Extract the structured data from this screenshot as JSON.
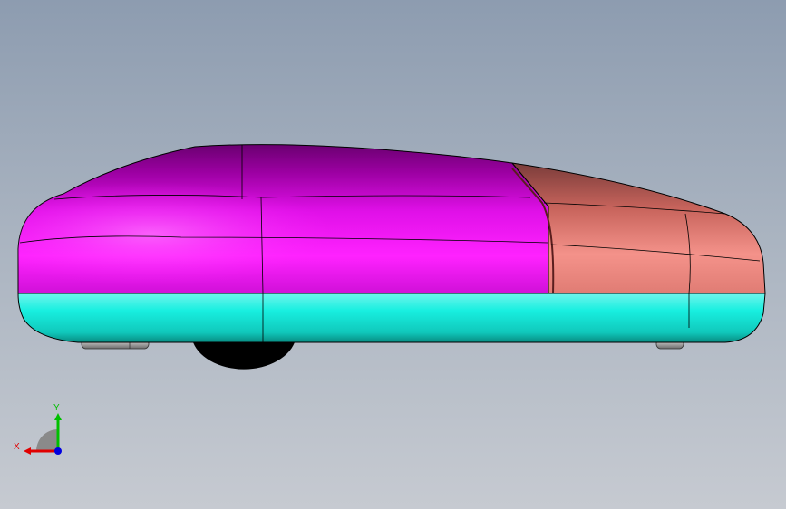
{
  "viewport": {
    "background_top": "#8d9cb0",
    "background_bottom": "#c6cad1"
  },
  "model": {
    "parts": [
      {
        "name": "upper-body-shell",
        "color": "#ff1aff"
      },
      {
        "name": "front-hood-shell",
        "color": "#f08a80"
      },
      {
        "name": "lower-base",
        "color": "#19e8d8"
      },
      {
        "name": "rear-wheel",
        "color": "#000000"
      },
      {
        "name": "front-foot",
        "color": "#9a9a9a"
      },
      {
        "name": "rear-foot",
        "color": "#9a9a9a"
      }
    ]
  },
  "triad": {
    "x_label": "X",
    "y_label": "Y",
    "x_color": "#e00000",
    "y_color": "#00c000",
    "z_color": "#0000e0"
  }
}
